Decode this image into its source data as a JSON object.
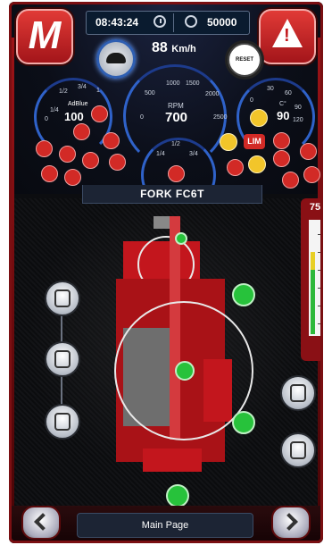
{
  "header": {
    "logo_letter": "M",
    "warning_symbol": "!",
    "time": "08:43:24",
    "hour_meter": "50000",
    "speed_value": "88",
    "speed_unit": "Km/h",
    "reset_label": "RESET"
  },
  "gauges": {
    "adblue_label": "AdBlue",
    "adblue_value": "100",
    "adblue_ticks": [
      "1/4",
      "1/2",
      "3/4",
      "0",
      "1"
    ],
    "rpm_label": "RPM",
    "rpm_value": "700",
    "rpm_ticks": [
      "1000",
      "1500",
      "500",
      "2000",
      "0",
      "2500"
    ],
    "temp_unit": "C°",
    "temp_value": "90",
    "temp_ticks": [
      "30",
      "60",
      "90",
      "0",
      "120"
    ],
    "fuel_ticks": [
      "1/4",
      "1/2",
      "3/4"
    ],
    "limit_label": "LIM"
  },
  "title": "FORK FC6T",
  "scale": {
    "value": "75"
  },
  "footer": {
    "page_label": "Main Page"
  },
  "colors": {
    "accent_red": "#c3161d",
    "gauge_blue": "#2f62c9",
    "ok_green": "#27c23b",
    "warn_yellow": "#f2c52a"
  },
  "icons": [
    "turtle-icon",
    "reset-gear-icon",
    "clock-icon",
    "hour-meter-icon",
    "warning-triangle-icon",
    "steering-mode-icon",
    "jib-icon"
  ]
}
